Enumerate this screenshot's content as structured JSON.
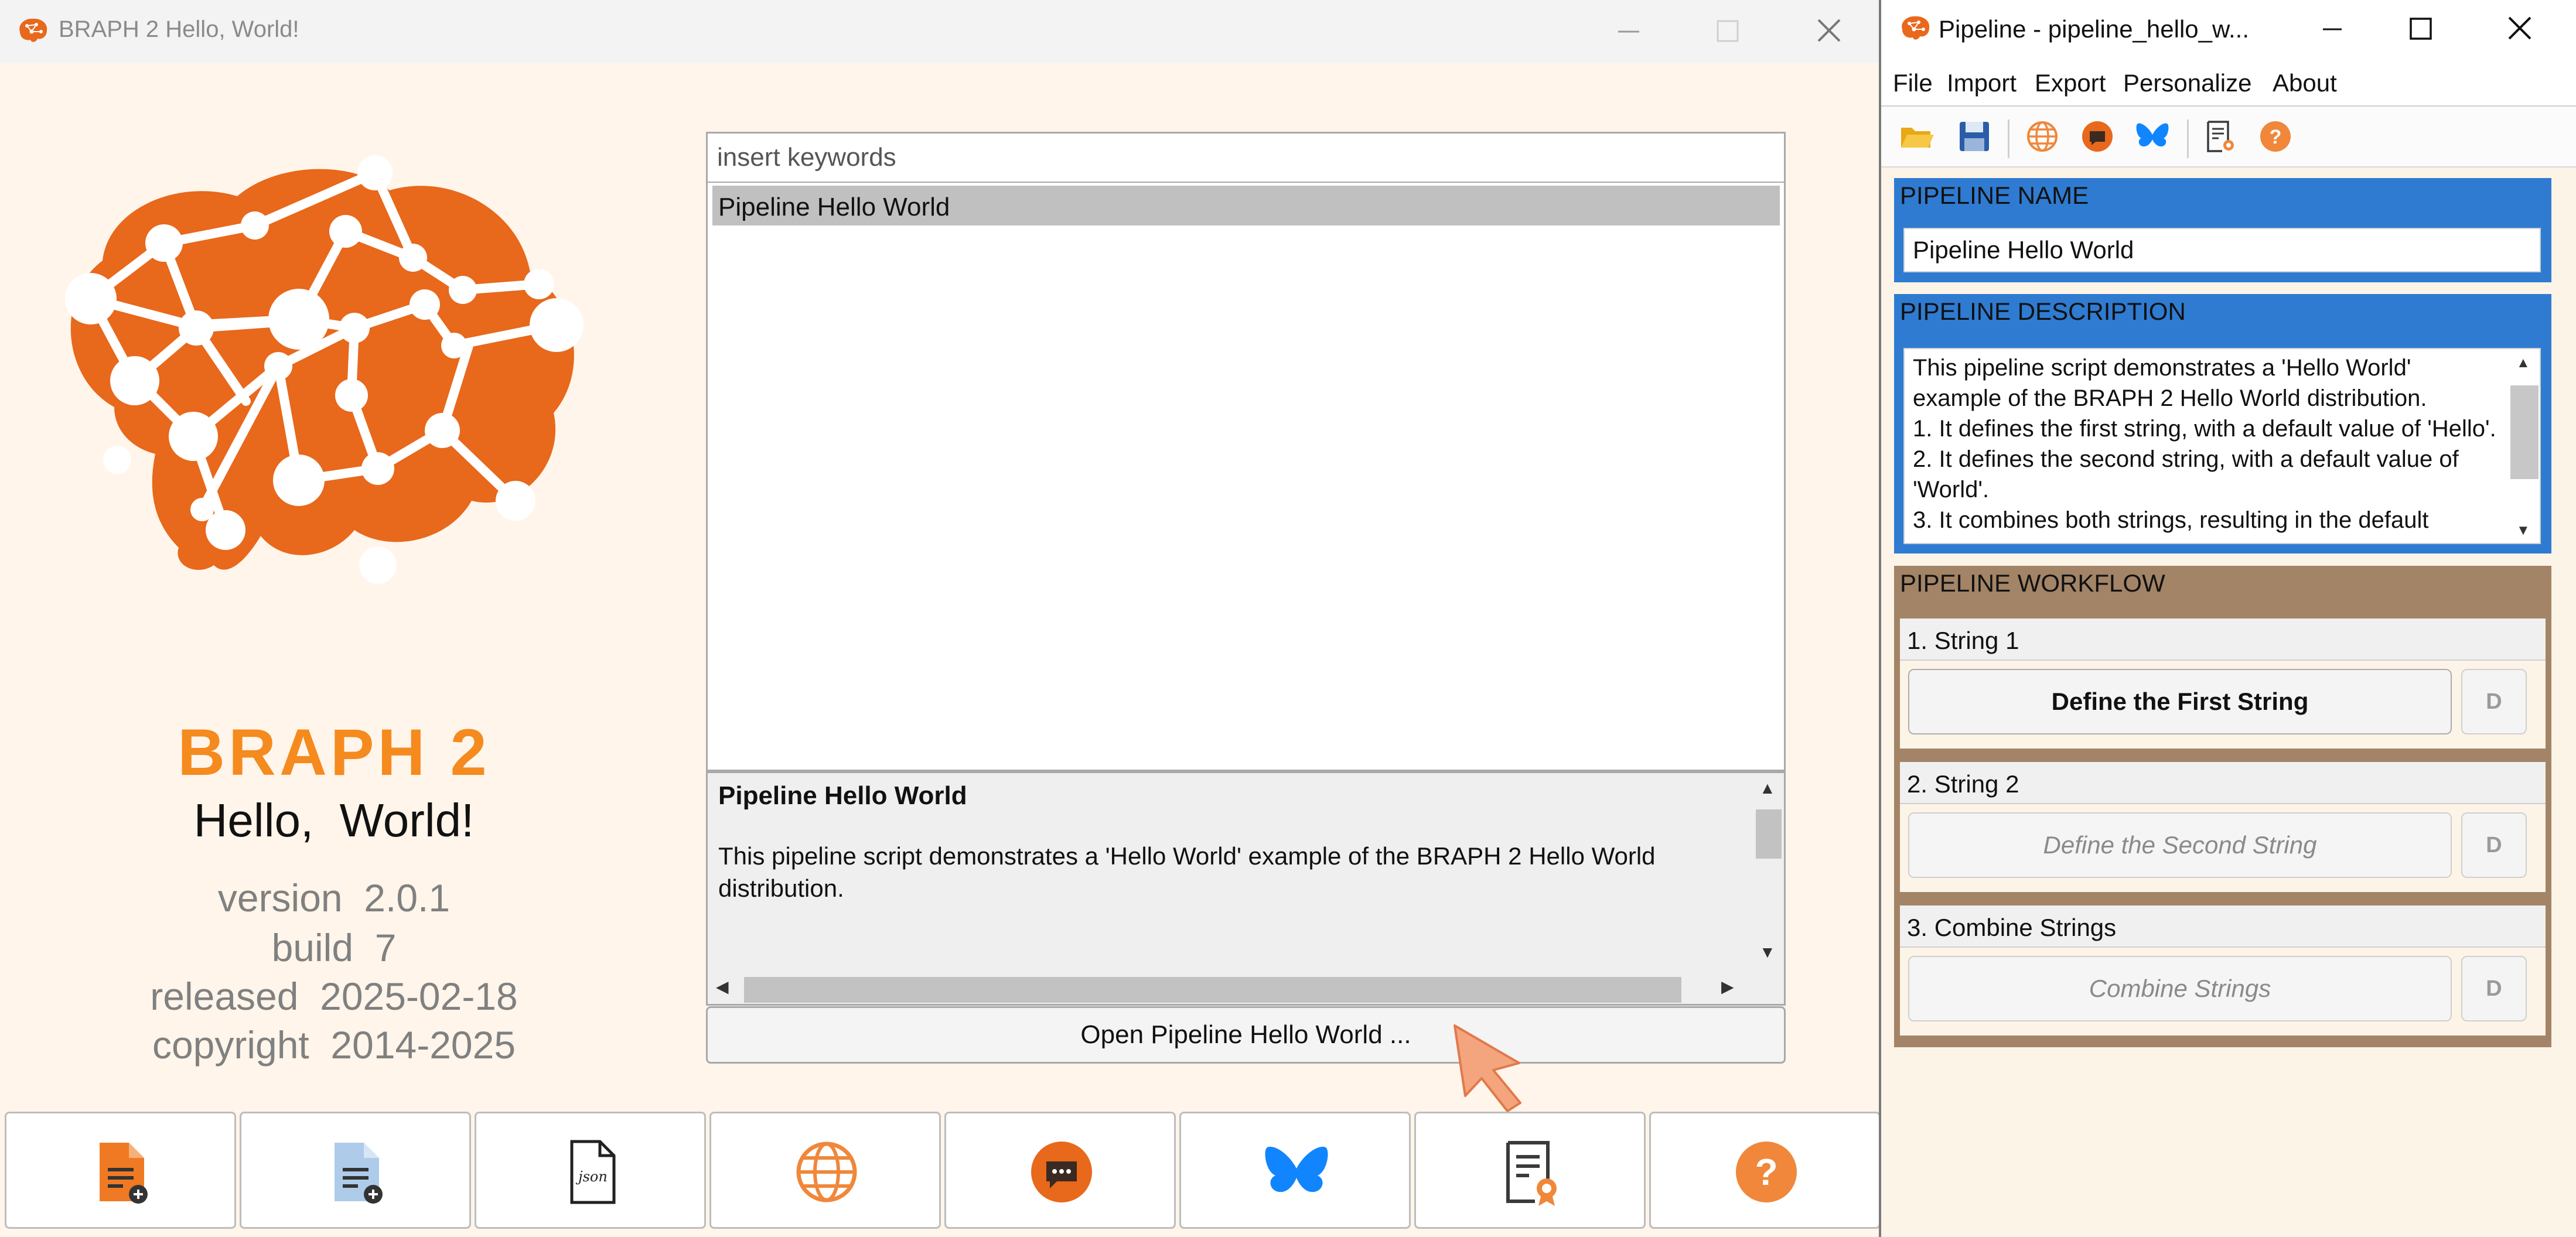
{
  "main_window": {
    "title": "BRAPH 2 Hello, World!",
    "brand": {
      "name": "BRAPH  2",
      "subtitle": "Hello,  World!",
      "version": "version  2.0.1",
      "build": "build  7",
      "released": "released  2025-02-18",
      "copyright": "copyright  2014-2025"
    },
    "search": {
      "placeholder": "insert keywords",
      "value": ""
    },
    "pipeline_list": [
      "Pipeline Hello World"
    ],
    "selected_pipeline": {
      "title": "Pipeline Hello World",
      "description": "This pipeline script demonstrates a 'Hello World' example of the BRAPH 2 Hello World distribution."
    },
    "open_button_label": "Open Pipeline Hello World ...",
    "toolbar_icons": [
      "open-pipeline-icon",
      "new-pipeline-icon",
      "json-icon",
      "website-icon",
      "forum-icon",
      "bluesky-icon",
      "license-icon",
      "help-icon"
    ]
  },
  "pipeline_window": {
    "title": "Pipeline - pipeline_hello_w...",
    "menu": [
      "File",
      "Import",
      "Export",
      "Personalize",
      "About"
    ],
    "toolbar_icons": [
      "open-folder-icon",
      "save-icon",
      "website-icon",
      "forum-icon",
      "bluesky-icon",
      "license-icon",
      "help-icon"
    ],
    "name_panel": {
      "label": "PIPELINE NAME",
      "value": "Pipeline Hello World"
    },
    "description_panel": {
      "label": "PIPELINE DESCRIPTION",
      "text": "This pipeline script demonstrates a 'Hello World' example of the BRAPH 2 Hello World distribution.\n1. It defines the first string, with a default value of 'Hello'.\n2. It defines the second string, with a default value of 'World'.\n3. It combines both strings, resulting in the default"
    },
    "workflow_panel": {
      "label": "PIPELINE WORKFLOW",
      "steps": [
        {
          "title": "1. String 1",
          "button": "Define the First String",
          "d_label": "D",
          "enabled": true
        },
        {
          "title": "2. String 2",
          "button": "Define the Second String",
          "d_label": "D",
          "enabled": false
        },
        {
          "title": "3. Combine Strings",
          "button": "Combine Strings",
          "d_label": "D",
          "enabled": false
        }
      ]
    }
  },
  "colors": {
    "brand_orange": "#f58a1f",
    "brain_orange": "#e8681c",
    "panel_blue": "#2f7bd1",
    "panel_brown": "#a38467"
  }
}
